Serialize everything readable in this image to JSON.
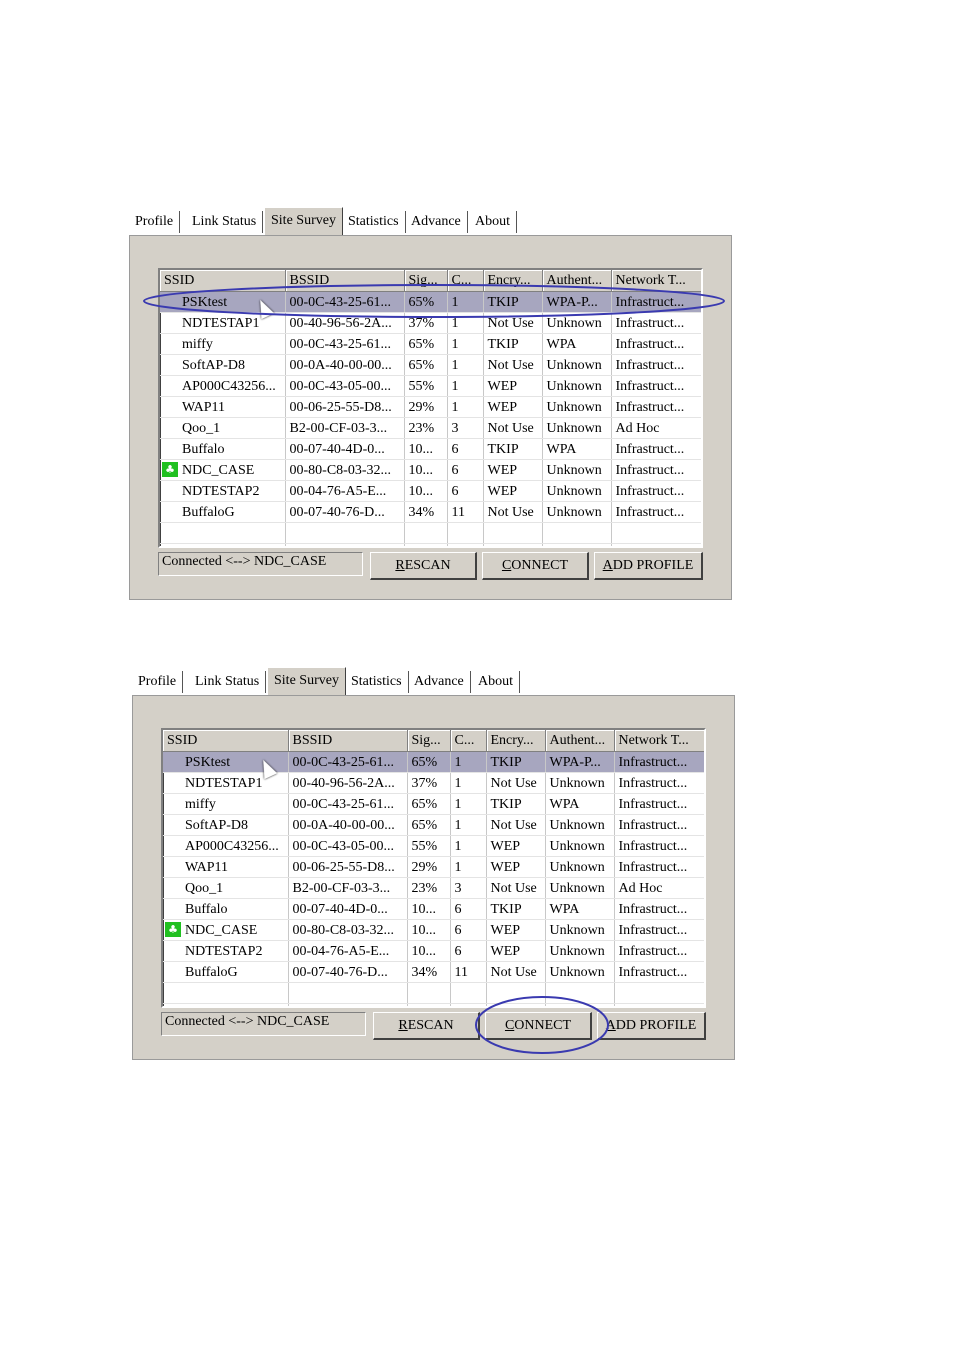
{
  "tabs": [
    "Profile",
    "Link Status",
    "Site Survey",
    "Statistics",
    "Advance",
    "About"
  ],
  "active_tab": "Site Survey",
  "columns": [
    "SSID",
    "BSSID",
    "Sig...",
    "C...",
    "Encry...",
    "Authent...",
    "Network T..."
  ],
  "rows": [
    [
      "PSKtest",
      "00-0C-43-25-61...",
      "65%",
      "1",
      "TKIP",
      "WPA-P...",
      "Infrastruct..."
    ],
    [
      "NDTESTAP1",
      "00-40-96-56-2A...",
      "37%",
      "1",
      "Not Use",
      "Unknown",
      "Infrastruct..."
    ],
    [
      "miffy",
      "00-0C-43-25-61...",
      "65%",
      "1",
      "TKIP",
      "WPA",
      "Infrastruct..."
    ],
    [
      "SoftAP-D8",
      "00-0A-40-00-00...",
      "65%",
      "1",
      "Not Use",
      "Unknown",
      "Infrastruct..."
    ],
    [
      "AP000C43256...",
      "00-0C-43-05-00...",
      "55%",
      "1",
      "WEP",
      "Unknown",
      "Infrastruct..."
    ],
    [
      "WAP11",
      "00-06-25-55-D8...",
      "29%",
      "1",
      "WEP",
      "Unknown",
      "Infrastruct..."
    ],
    [
      "Qoo_1",
      "B2-00-CF-03-3...",
      "23%",
      "3",
      "Not Use",
      "Unknown",
      "Ad Hoc"
    ],
    [
      "Buffalo",
      "00-07-40-4D-0...",
      "10...",
      "6",
      "TKIP",
      "WPA",
      "Infrastruct..."
    ],
    [
      "NDC_CASE",
      "00-80-C8-03-32...",
      "10...",
      "6",
      "WEP",
      "Unknown",
      "Infrastruct..."
    ],
    [
      "NDTESTAP2",
      "00-04-76-A5-E...",
      "10...",
      "6",
      "WEP",
      "Unknown",
      "Infrastruct..."
    ],
    [
      "BuffaloG",
      "00-07-40-76-D...",
      "34%",
      "11",
      "Not Use",
      "Unknown",
      "Infrastruct..."
    ]
  ],
  "connected_row": 8,
  "status_text": "Connected <--> NDC_CASE",
  "buttons": {
    "rescan": {
      "hotkey": "R",
      "rest": "ESCAN"
    },
    "connect": {
      "hotkey": "C",
      "rest": "ONNECT"
    },
    "add_profile": {
      "hotkey": "A",
      "rest": "DD PROFILE"
    }
  },
  "colors": {
    "selected_row": "#a7a6bf",
    "annotation_ellipse": "#3a3ab0",
    "connected_icon": "#20c020"
  },
  "icons": {
    "connected": "connected-signal-icon",
    "pointer": "mouse-cursor-icon"
  }
}
